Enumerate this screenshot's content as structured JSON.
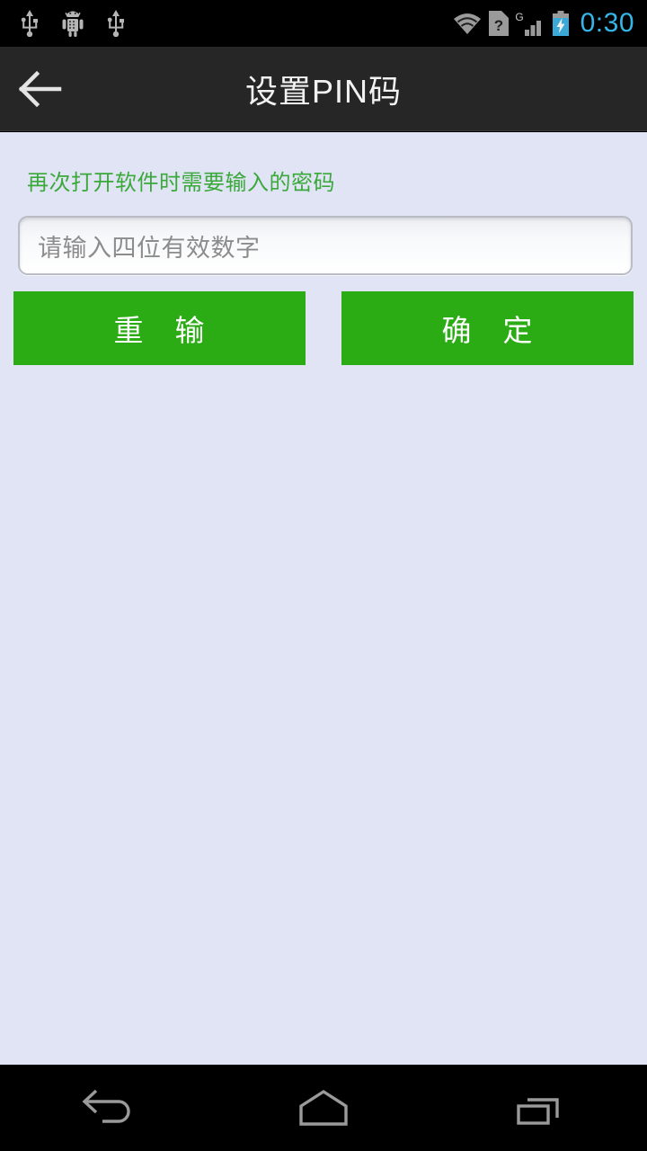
{
  "status_bar": {
    "left_icons": [
      "usb-icon",
      "android-debug-icon",
      "usb-icon"
    ],
    "right_icons": [
      "wifi-icon",
      "sim-unknown-icon",
      "g-signal-icon",
      "battery-charging-icon"
    ],
    "time": "0:30",
    "time_color": "#36b6e8"
  },
  "title_bar": {
    "back_icon": "back-arrow-icon",
    "title": "设置PIN码",
    "background_color": "#262626"
  },
  "content": {
    "background_color": "#e0e4f5",
    "hint": "再次打开软件时需要输入的密码",
    "hint_color": "#3aa93a",
    "pin_input": {
      "value": "",
      "placeholder": "请输入四位有效数字"
    },
    "buttons": {
      "reset_label": "重　输",
      "confirm_label": "确　定",
      "color": "#2bab14"
    }
  },
  "nav_bar": {
    "keys": [
      "back-nav-icon",
      "home-nav-icon",
      "recents-nav-icon"
    ]
  }
}
